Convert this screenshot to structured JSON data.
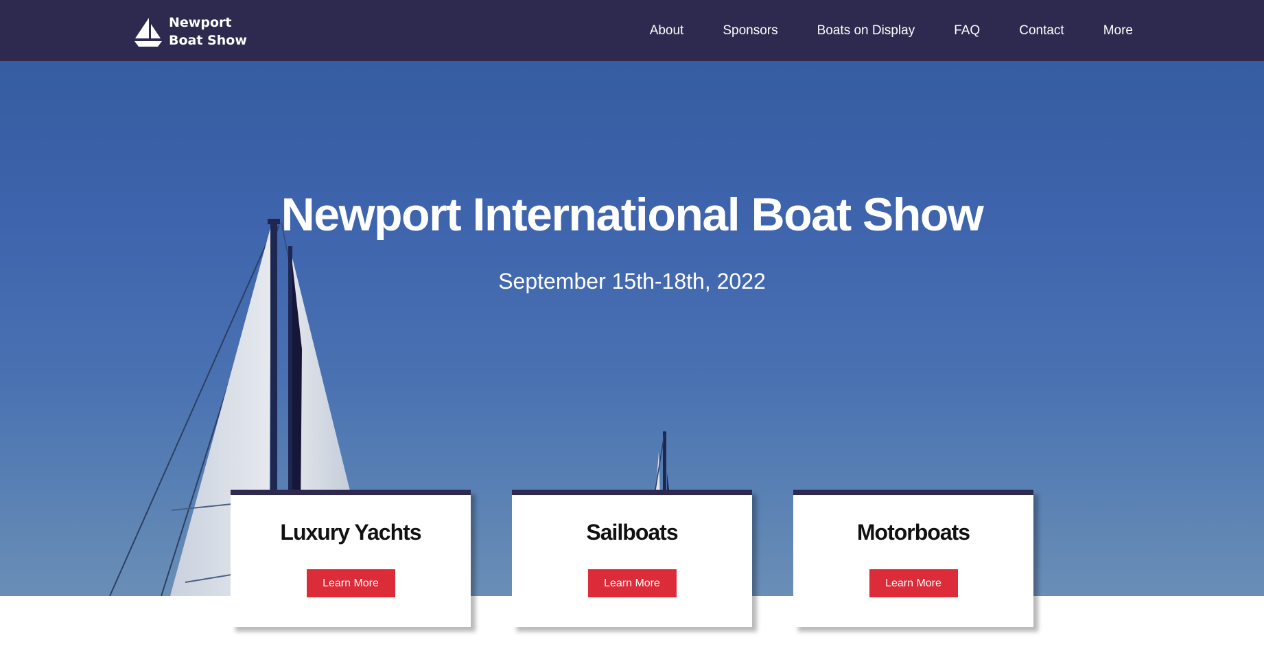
{
  "header": {
    "logo_line1": "Newport",
    "logo_line2": "Boat Show",
    "logo_icon": "sailboat-icon",
    "nav": [
      {
        "label": "About"
      },
      {
        "label": "Sponsors"
      },
      {
        "label": "Boats on Display"
      },
      {
        "label": "FAQ"
      },
      {
        "label": "Contact"
      },
      {
        "label": "More"
      }
    ]
  },
  "hero": {
    "title": "Newport International Boat Show",
    "date": "September 15th-18th, 2022"
  },
  "cards": [
    {
      "title": "Luxury Yachts",
      "button": "Learn More"
    },
    {
      "title": "Sailboats",
      "button": "Learn More"
    },
    {
      "title": "Motorboats",
      "button": "Learn More"
    }
  ],
  "colors": {
    "header_bg": "#2e2a4f",
    "button_red": "#dc2c39",
    "sky_blue": "#3e64ad",
    "text_white": "#ffffff"
  }
}
